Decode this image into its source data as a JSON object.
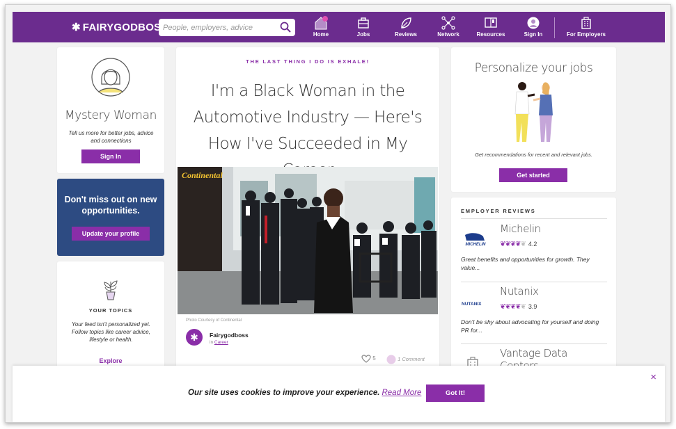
{
  "nav": {
    "logo": "FAIRYGODBOSS",
    "search_placeholder": "People, employers, advice",
    "items": [
      {
        "label": "Home",
        "icon": "home-icon"
      },
      {
        "label": "Jobs",
        "icon": "briefcase-icon"
      },
      {
        "label": "Reviews",
        "icon": "leaf-icon"
      },
      {
        "label": "Network",
        "icon": "network-icon"
      },
      {
        "label": "Resources",
        "icon": "book-icon"
      },
      {
        "label": "Sign In",
        "icon": "avatar-icon"
      },
      {
        "label": "For Employers",
        "icon": "building-icon"
      }
    ],
    "accent": "#6b2c8e"
  },
  "profile_card": {
    "name": "Mystery Woman",
    "subtitle": "Tell us more for better jobs, advice and connections",
    "button": "Sign In"
  },
  "promo_card": {
    "title": "Don't miss out on new opportunities.",
    "button": "Update your profile"
  },
  "topics_card": {
    "heading": "YOUR TOPICS",
    "text": "Your feed isn't personalized yet. Follow topics like career advice, lifestyle or health.",
    "link": "Explore"
  },
  "article": {
    "kicker": "THE LAST THING I DO IS EXHALE!",
    "title": "I'm a Black Woman in the Automotive Industry — Here's How I've Succeeded in My Career",
    "photo_credit": "Photo Courtesy of Continental",
    "photo_sign": "Continental",
    "author": "Fairygodboss",
    "in_label": "in",
    "category": "Career",
    "likes": "5",
    "comments": "1 Comment"
  },
  "personalize_card": {
    "title": "Personalize your jobs",
    "subtitle": "Get recommendations for recent and relevant jobs.",
    "button": "Get started"
  },
  "employer_reviews": {
    "heading": "EMPLOYER REVIEWS",
    "items": [
      {
        "name": "Michelin",
        "rating": "4.2",
        "leaves": 4,
        "logo_text": "MICHELIN",
        "text": "Great benefits and opportunities for growth. They value..."
      },
      {
        "name": "Nutanix",
        "rating": "3.9",
        "leaves": 4,
        "logo_text": "NUTANIX",
        "text": "Don't be shy about advocating for yourself and doing PR for..."
      },
      {
        "name": "Vantage Data Centers"
      }
    ]
  },
  "cookie": {
    "text": "Our site uses cookies to improve your experience.",
    "link": "Read More",
    "button": "Got It!",
    "close": "×"
  }
}
